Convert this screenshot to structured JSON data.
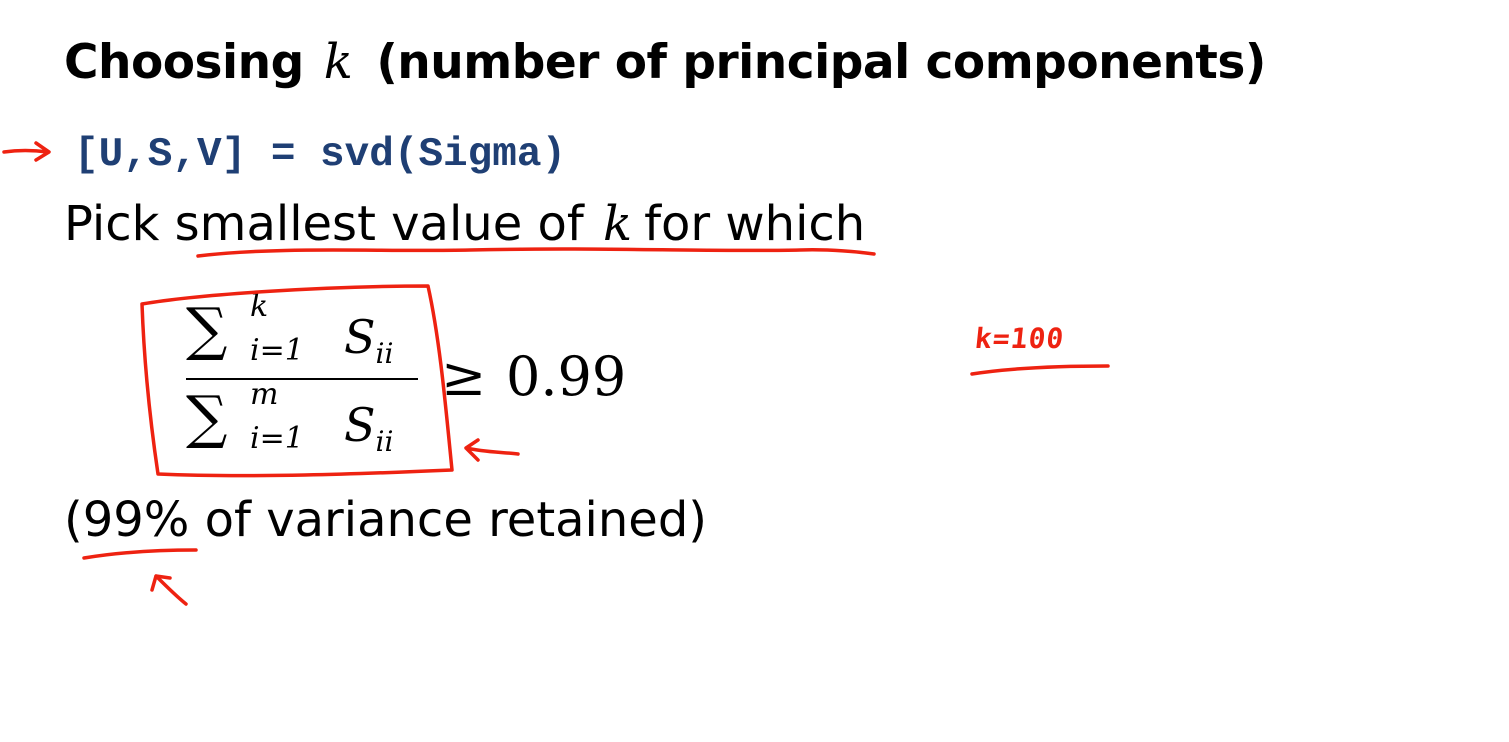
{
  "slide": {
    "title_prefix": "Choosing",
    "title_var": "k",
    "title_suffix": "(number of principal components)",
    "code_line": "[U,S,V] = svd(Sigma)",
    "pick_prefix": "Pick smallest value of",
    "pick_var": "k",
    "pick_suffix": "for which",
    "formula": {
      "sum_symbol": "∑",
      "num_upper": "k",
      "num_lower": "i=1",
      "den_upper": "m",
      "den_lower": "i=1",
      "term": "S",
      "term_sub": "ii",
      "relation": "≥",
      "threshold": "0.99"
    },
    "variance_note": "(99% of variance retained)"
  },
  "annotations": {
    "color": "#ee2211",
    "handwritten_note": "k=100"
  }
}
